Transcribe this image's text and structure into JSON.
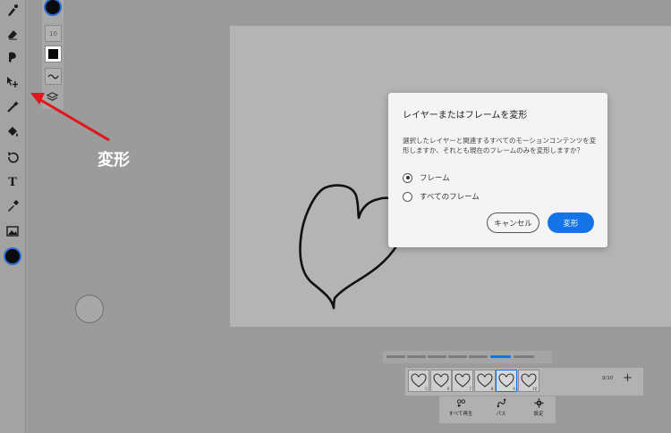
{
  "left_toolbar": {
    "tools": [
      {
        "name": "brush-icon"
      },
      {
        "name": "eraser-icon"
      },
      {
        "name": "smudge-icon"
      },
      {
        "name": "transform-icon"
      },
      {
        "name": "magic-wand-icon"
      },
      {
        "name": "fill-icon"
      },
      {
        "name": "rotate-icon"
      },
      {
        "name": "text-tool-icon",
        "glyph": "T"
      },
      {
        "name": "eyedropper-icon"
      },
      {
        "name": "image-icon"
      }
    ],
    "color": "#0b0b0b"
  },
  "sub_toolbar": {
    "size_value": "10",
    "swatch_color": "#0a0a0a"
  },
  "annotation": {
    "label": "変形",
    "arrow_color": "#e0161b"
  },
  "dialog": {
    "title": "レイヤーまたはフレームを変形",
    "body": "選択したレイヤーと関連するすべてのモーションコンテンツを変形しますか、それとも現在のフレームのみを変形しますか？",
    "options": [
      {
        "label": "フレーム",
        "selected": true
      },
      {
        "label": "すべてのフレーム",
        "selected": false
      }
    ],
    "cancel_label": "キャンセル",
    "confirm_label": "変形",
    "accent_color": "#1473e6"
  },
  "timeline": {
    "frames": [
      {
        "num": "5"
      },
      {
        "num": "6"
      },
      {
        "num": "7"
      },
      {
        "num": "8"
      },
      {
        "num": "9",
        "active": true
      },
      {
        "num": "10"
      }
    ],
    "counter": "9/10",
    "add_label": "+"
  },
  "bottom_bar": {
    "play_all": "すべて再生",
    "path": "パス",
    "settings": "設定"
  }
}
